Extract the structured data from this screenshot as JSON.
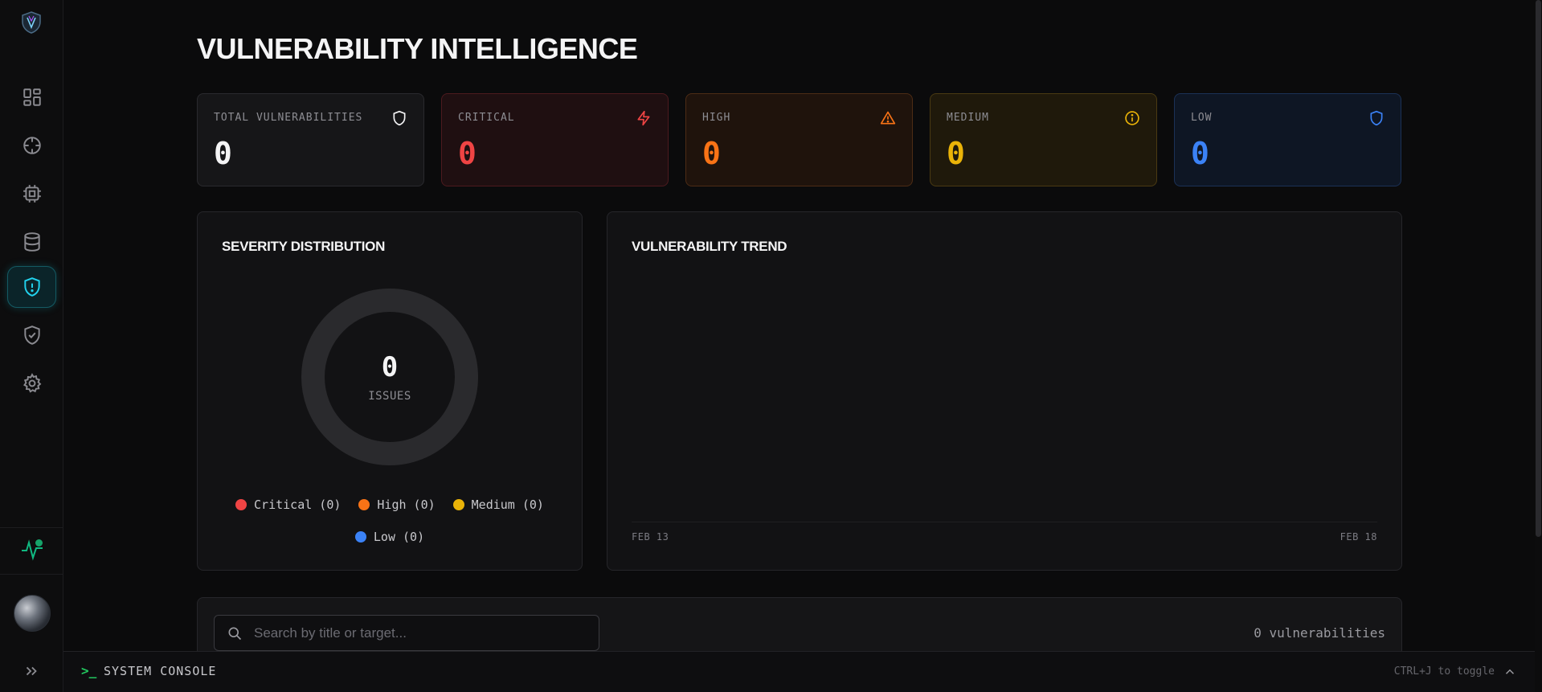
{
  "page": {
    "title": "VULNERABILITY INTELLIGENCE"
  },
  "sidebar": {
    "items": [
      {
        "icon": "dashboard-icon",
        "active": false
      },
      {
        "icon": "crosshair-icon",
        "active": false
      },
      {
        "icon": "cpu-icon",
        "active": false
      },
      {
        "icon": "database-icon",
        "active": false
      },
      {
        "icon": "shield-alert-icon",
        "active": true
      },
      {
        "icon": "shield-check-icon",
        "active": false
      },
      {
        "icon": "gear-icon",
        "active": false
      }
    ],
    "status_icon": "activity-icon",
    "expand_icon": "chevrons-right-icon"
  },
  "stats": [
    {
      "label": "TOTAL VULNERABILITIES",
      "value": "0",
      "icon": "shield-icon",
      "color": "#f4f4f5"
    },
    {
      "label": "CRITICAL",
      "value": "0",
      "icon": "zap-icon",
      "color": "#ef4444"
    },
    {
      "label": "HIGH",
      "value": "0",
      "icon": "alert-triangle-icon",
      "color": "#f97316"
    },
    {
      "label": "MEDIUM",
      "value": "0",
      "icon": "info-icon",
      "color": "#eab308"
    },
    {
      "label": "LOW",
      "value": "0",
      "icon": "shield-icon",
      "color": "#3b82f6"
    }
  ],
  "severity": {
    "title": "SEVERITY DISTRIBUTION",
    "total": "0",
    "total_label": "ISSUES",
    "legend": [
      {
        "label": "Critical (0)",
        "color": "#ef4444"
      },
      {
        "label": "High (0)",
        "color": "#f97316"
      },
      {
        "label": "Medium (0)",
        "color": "#eab308"
      },
      {
        "label": "Low (0)",
        "color": "#3b82f6"
      }
    ]
  },
  "trend": {
    "title": "VULNERABILITY TREND",
    "x_start": "FEB 13",
    "x_end": "FEB 18"
  },
  "list": {
    "search_placeholder": "Search by title or target...",
    "count": "0 vulnerabilities"
  },
  "console": {
    "prompt": ">_",
    "title": "SYSTEM CONSOLE",
    "hint": "CTRL+J to toggle"
  }
}
